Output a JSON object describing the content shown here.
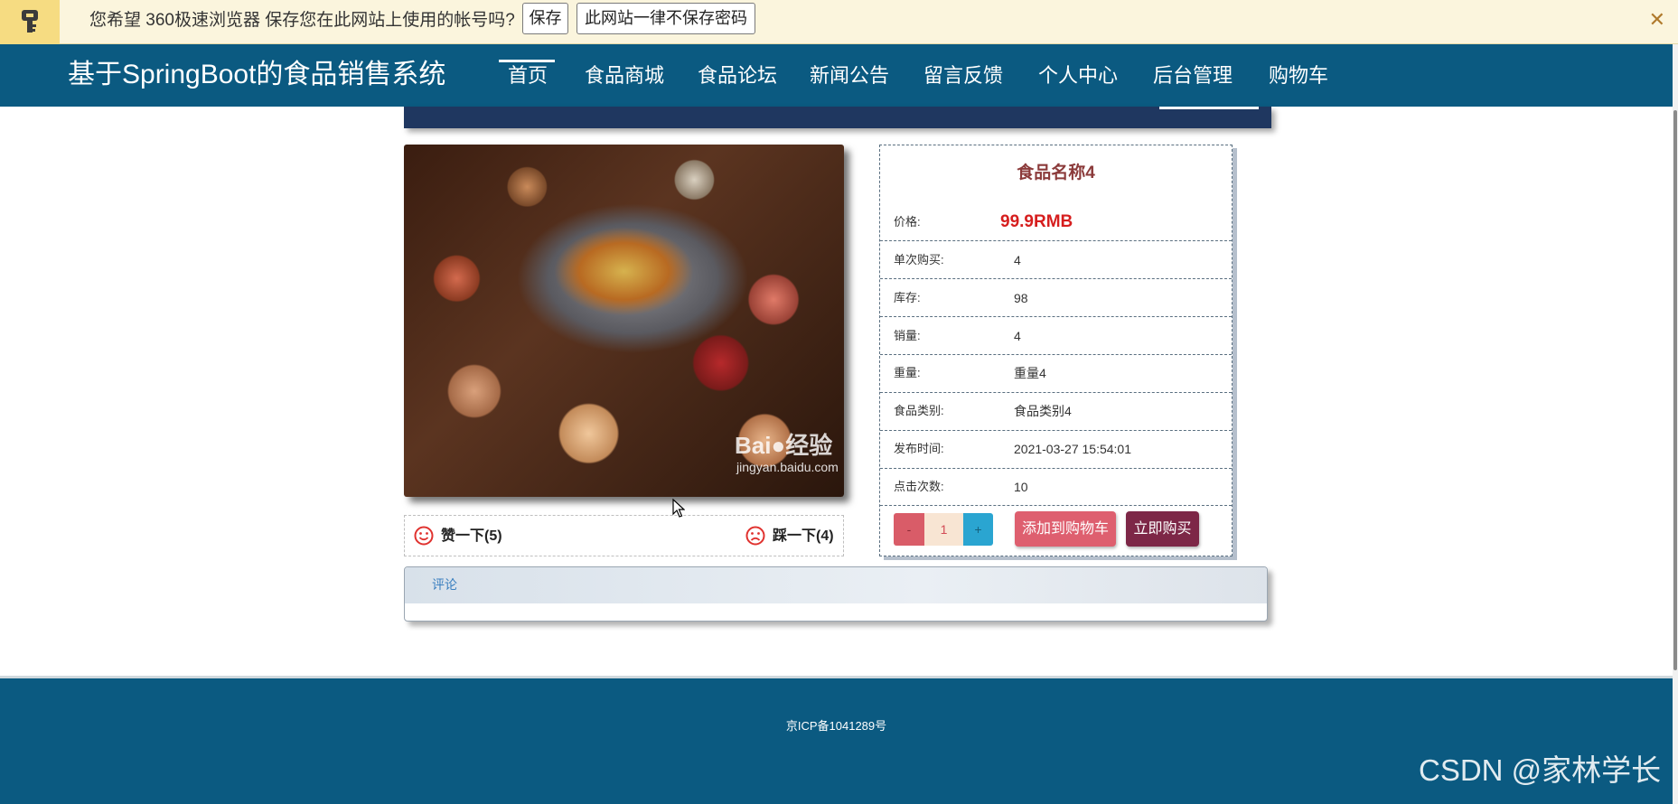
{
  "password_bar": {
    "message": "您希望 360极速浏览器 保存您在此网站上使用的帐号吗?",
    "save_label": "保存",
    "never_label": "此网站一律不保存密码",
    "close_glyph": "✕",
    "key_icon": "key-icon"
  },
  "nav": {
    "brand": "基于SpringBoot的食品销售系统",
    "items": [
      {
        "label": "首页",
        "active": true
      },
      {
        "label": "食品商城"
      },
      {
        "label": "食品论坛"
      },
      {
        "label": "新闻公告"
      },
      {
        "label": "留言反馈"
      },
      {
        "label": "个人中心"
      },
      {
        "label": "后台管理"
      },
      {
        "label": "购物车"
      }
    ]
  },
  "image": {
    "watermark_brand": "Bai",
    "watermark_brand_2": "经验",
    "watermark_url": "jingyan.baidu.com"
  },
  "votes": {
    "like_label": "赞一下(5)",
    "dislike_label": "踩一下(4)",
    "like_icon": "smile-icon",
    "dislike_icon": "frown-icon"
  },
  "product": {
    "title": "食品名称4",
    "price_label": "价格:",
    "price_value": "99.9RMB",
    "rows": [
      {
        "label": "单次购买:",
        "value": "4"
      },
      {
        "label": "库存:",
        "value": "98"
      },
      {
        "label": "销量:",
        "value": "4"
      },
      {
        "label": "重量:",
        "value": "重量4"
      },
      {
        "label": "食品类别:",
        "value": "食品类别4"
      },
      {
        "label": "发布时间:",
        "value": "2021-03-27 15:54:01"
      },
      {
        "label": "点击次数:",
        "value": "10"
      }
    ],
    "qty_minus": "-",
    "qty_value": "1",
    "qty_plus": "+",
    "add_to_cart": "添加到购物车",
    "buy_now": "立即购买"
  },
  "comments": {
    "tab_label": "评论"
  },
  "footer": {
    "icp": "京ICP备1041289号",
    "watermark": "CSDN @家林学长"
  },
  "colors": {
    "nav_bg": "#0b5a81",
    "price": "#d61e1e",
    "cart_btn": "#de5f6f",
    "buy_btn": "#7d2747"
  }
}
